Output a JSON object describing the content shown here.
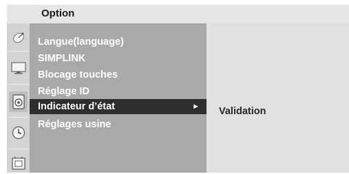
{
  "header": {
    "title": "Option"
  },
  "menu": {
    "items": [
      {
        "label": "Langue(language)"
      },
      {
        "label": "SIMPLINK"
      },
      {
        "label": "Blocage touches"
      },
      {
        "label": "Réglage ID"
      },
      {
        "label": "Indicateur d’état",
        "selected": true,
        "arrow": "►"
      },
      {
        "label": "Réglages usine"
      }
    ]
  },
  "submenu": {
    "items": [
      {
        "label": "Validation"
      }
    ]
  },
  "icons": [
    "satellite-dish-icon",
    "monitor-icon",
    "speaker-icon",
    "clock-icon",
    "option-box-icon"
  ],
  "colors": {
    "title_bar": "#e6e6e6",
    "icon_strip": "#d4d4d4",
    "menu_panel": "#a9a9a9",
    "selected_row": "#2e2e2e",
    "submenu_panel": "#e1e1e1"
  }
}
